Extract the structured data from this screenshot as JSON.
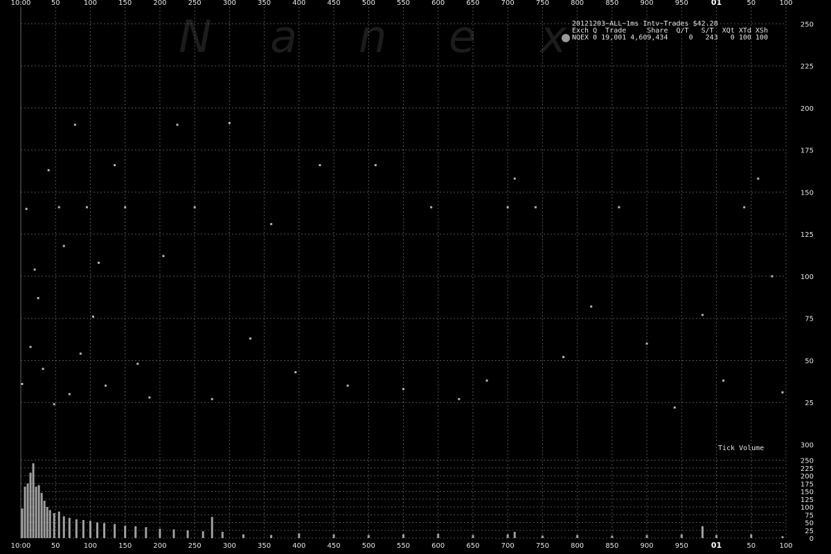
{
  "header": {
    "title_line": "20121203~ALL~1ms Intv~Trades $42.28",
    "columns_line": "Exch Q  Trade     Share  Q/T   S/T  XQt XTd XSh",
    "row_line": "NQEX 0 19,001 4,609,434     0   243   0 100 100",
    "legend_color": "#9a9a9a"
  },
  "watermark": [
    "N",
    "a",
    "n",
    "e",
    "x"
  ],
  "tick_volume_label": "Tick Volume",
  "chart_data": [
    {
      "type": "scatter",
      "title": "20121203~ALL~1ms Intv~Trades $42.28",
      "x_ticks": [
        "10:00",
        "50",
        "100",
        "150",
        "200",
        "250",
        "300",
        "350",
        "400",
        "450",
        "500",
        "550",
        "600",
        "650",
        "700",
        "750",
        "800",
        "850",
        "900",
        "950",
        "01",
        "50",
        "100"
      ],
      "y_ticks": [
        "25",
        "50",
        "75",
        "100",
        "125",
        "150",
        "175",
        "200",
        "225",
        "250"
      ],
      "ylim": [
        0,
        260
      ],
      "grid": true,
      "point_color": "#b4b4b4",
      "series": [
        {
          "name": "NQEX",
          "x": [
            2,
            8,
            14,
            20,
            25,
            32,
            40,
            48,
            55,
            62,
            70,
            78,
            86,
            95,
            104,
            112,
            122,
            135,
            150,
            168,
            185,
            205,
            225,
            250,
            275,
            300,
            330,
            360,
            395,
            430,
            470,
            510,
            550,
            590,
            630,
            670,
            700,
            710,
            740,
            780,
            820,
            860,
            900,
            940,
            980,
            1010,
            1040,
            1060,
            1080,
            1095
          ],
          "y": [
            36,
            140,
            58,
            104,
            87,
            45,
            163,
            24,
            141,
            118,
            30,
            190,
            54,
            141,
            76,
            108,
            35,
            166,
            141,
            48,
            28,
            112,
            190,
            141,
            27,
            191,
            63,
            131,
            43,
            166,
            35,
            166,
            33,
            141,
            27,
            38,
            141,
            158,
            141,
            52,
            82,
            141,
            60,
            22,
            77,
            38,
            141,
            158,
            100,
            31
          ]
        }
      ]
    },
    {
      "type": "bar",
      "title": "Tick Volume",
      "x_ticks": [
        "10:00",
        "50",
        "100",
        "150",
        "200",
        "250",
        "300",
        "350",
        "400",
        "450",
        "500",
        "550",
        "600",
        "650",
        "700",
        "750",
        "800",
        "850",
        "900",
        "950",
        "01",
        "50",
        "100"
      ],
      "y_ticks": [
        "0",
        "25",
        "50",
        "75",
        "100",
        "125",
        "150",
        "175",
        "200",
        "225",
        "250",
        "300"
      ],
      "ylim": [
        0,
        300
      ],
      "bar_color": "#a0a0a0",
      "x": [
        2,
        6,
        10,
        14,
        18,
        22,
        26,
        30,
        34,
        38,
        42,
        48,
        55,
        62,
        70,
        80,
        90,
        100,
        110,
        120,
        135,
        150,
        165,
        180,
        200,
        220,
        240,
        262,
        275,
        290,
        320,
        360,
        400,
        450,
        500,
        550,
        600,
        650,
        700,
        710,
        750,
        800,
        850,
        900,
        950,
        980,
        1000,
        1050,
        1095
      ],
      "values": [
        95,
        165,
        175,
        210,
        240,
        165,
        170,
        145,
        120,
        100,
        90,
        80,
        85,
        70,
        65,
        60,
        58,
        55,
        50,
        48,
        45,
        40,
        38,
        35,
        30,
        28,
        25,
        22,
        68,
        20,
        12,
        10,
        15,
        12,
        10,
        12,
        14,
        10,
        12,
        20,
        8,
        10,
        8,
        10,
        12,
        38,
        10,
        12,
        6
      ]
    }
  ]
}
